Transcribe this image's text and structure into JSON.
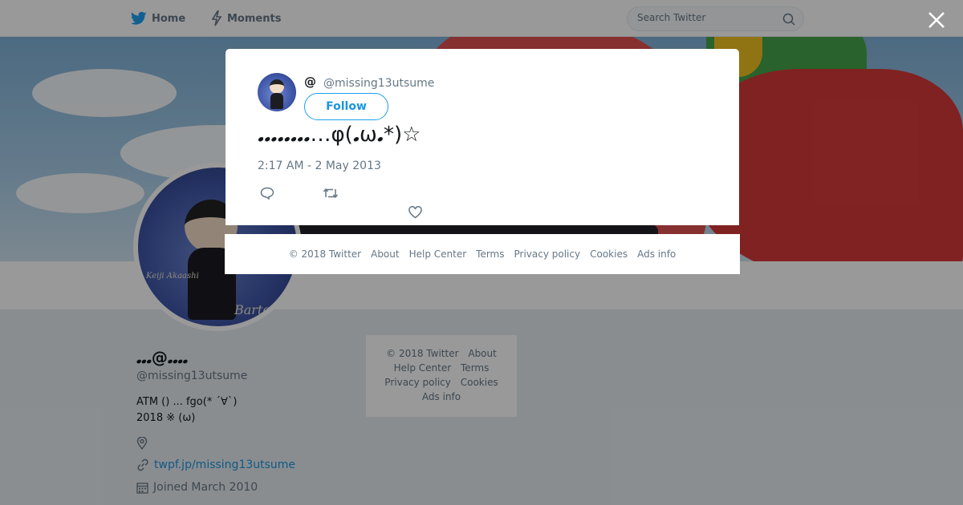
{
  "nav": {
    "home_label": "Home",
    "moments_label": "Moments",
    "search_placeholder": "Search Twitter"
  },
  "profile": {
    "name": "𝅘𝅘𝅘@𝅘𝅘𝅘𝅘",
    "handle": "@missing13utsume",
    "bio": "ATM () ...  fgo(* ´∀`) 2018 ※ (ω)",
    "website": "twpf.jp/missing13utsume",
    "joined": "Joined March 2010",
    "avatar_texts": {
      "barter": "Barter",
      "keiji": "Keiji Akaashi"
    }
  },
  "sidebar_footer": {
    "items": [
      "© 2018 Twitter",
      "About",
      "Help Center",
      "Terms",
      "Privacy policy",
      "Cookies",
      "Ads info"
    ]
  },
  "modal": {
    "name": "@",
    "handle": "@missing13utsume",
    "follow_label": "Follow",
    "tweet_text": "𝅘𝅘𝅘𝅘𝅘𝅘𝅘𝅘…φ(𝅘ω𝅘*)☆",
    "timestamp": "2:17 AM - 2 May 2013"
  },
  "modal_footer": {
    "items": [
      "© 2018 Twitter",
      "About",
      "Help Center",
      "Terms",
      "Privacy policy",
      "Cookies",
      "Ads info"
    ]
  },
  "colors": {
    "accent": "#1da1f2",
    "link": "#1b95e0",
    "muted": "#657786",
    "overlay": "rgba(0,0,0,0.40)"
  },
  "icons": [
    "twitter-bird-icon",
    "lightning-icon",
    "search-icon",
    "close-icon",
    "location-icon",
    "link-icon",
    "calendar-icon",
    "reply-icon",
    "retweet-icon",
    "heart-icon"
  ]
}
